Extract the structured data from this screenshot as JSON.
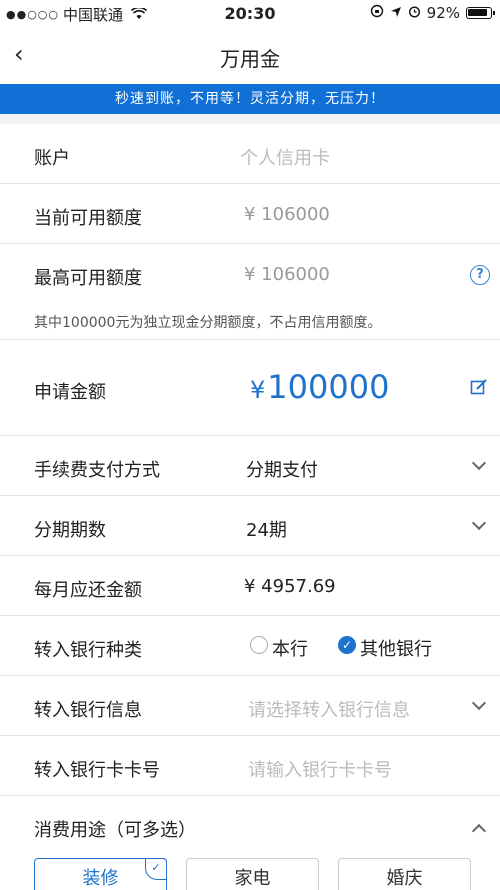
{
  "status": {
    "signal": "●●○○○",
    "carrier": "中国联通",
    "time": "20:30",
    "battery": "92%"
  },
  "nav": {
    "back": "‹",
    "title": "万用金"
  },
  "banner": "秒速到账，不用等！灵活分期，无压力！",
  "form": {
    "account": {
      "label": "账户",
      "value": "个人信用卡"
    },
    "available": {
      "label": "当前可用额度",
      "value": "¥ 106000"
    },
    "max_available": {
      "label": "最高可用额度",
      "value": "¥ 106000",
      "help": "?"
    },
    "note": "其中100000元为独立现金分期额度，不占用信用额度。",
    "apply": {
      "label": "申请金额",
      "yen": "¥",
      "amount": "100000"
    },
    "fee_payment": {
      "label": "手续费支付方式",
      "value": "分期支付"
    },
    "periods": {
      "label": "分期期数",
      "value": "24期"
    },
    "monthly": {
      "label": "每月应还金额",
      "value": "¥ 4957.69"
    },
    "bank_type": {
      "label": "转入银行种类",
      "option_own": "本行",
      "option_other": "其他银行"
    },
    "bank_info": {
      "label": "转入银行信息",
      "placeholder": "请选择转入银行信息"
    },
    "card_no": {
      "label": "转入银行卡卡号",
      "placeholder": "请输入银行卡卡号"
    },
    "purpose": {
      "label": "消费用途（可多选）",
      "options": [
        "装修",
        "家电",
        "婚庆"
      ],
      "selected": "装修"
    }
  },
  "colors": {
    "accent": "#1070d6",
    "amount": "#1f72cc"
  }
}
